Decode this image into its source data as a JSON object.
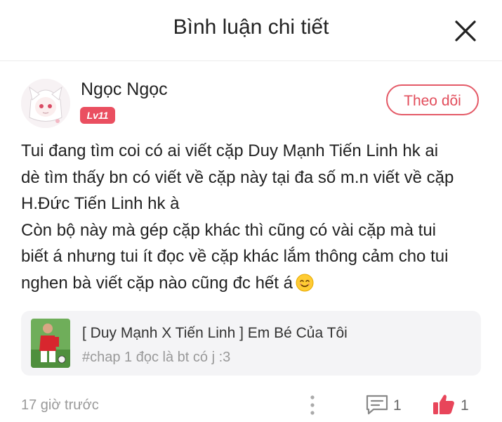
{
  "header": {
    "title": "Bình luận chi tiết",
    "close_icon": "close-icon"
  },
  "comment": {
    "author": "Ngọc Ngọc",
    "level": "Lv11",
    "follow_label": "Theo dõi",
    "lines": [
      "Tui đang tìm coi có ai viết cặp Duy Mạnh Tiến Linh hk ai",
      "dè tìm thấy bn có viết về cặp này tại đa số m.n viết về cặp",
      "H.Đức Tiến Linh hk à",
      "Còn bộ này mà gép cặp khác thì cũng có vài cặp mà tui",
      "biết á nhưng tui ít đọc về cặp khác lắm thông cảm cho tui",
      "nghen bà viết cặp nào cũng đc hết á"
    ],
    "emoji": "smiling-face-emoji",
    "time": "17 giờ trước",
    "reply_count": "1",
    "like_count": "1"
  },
  "reference": {
    "title": "[ Duy Mạnh X Tiến Linh ] Em Bé Của Tôi",
    "subtitle": "#chap 1 đọc là bt có j :3"
  },
  "colors": {
    "accent": "#e24e5c",
    "badge": "#ea4f60",
    "card_bg": "#f4f4f6",
    "muted_text": "#999999"
  }
}
